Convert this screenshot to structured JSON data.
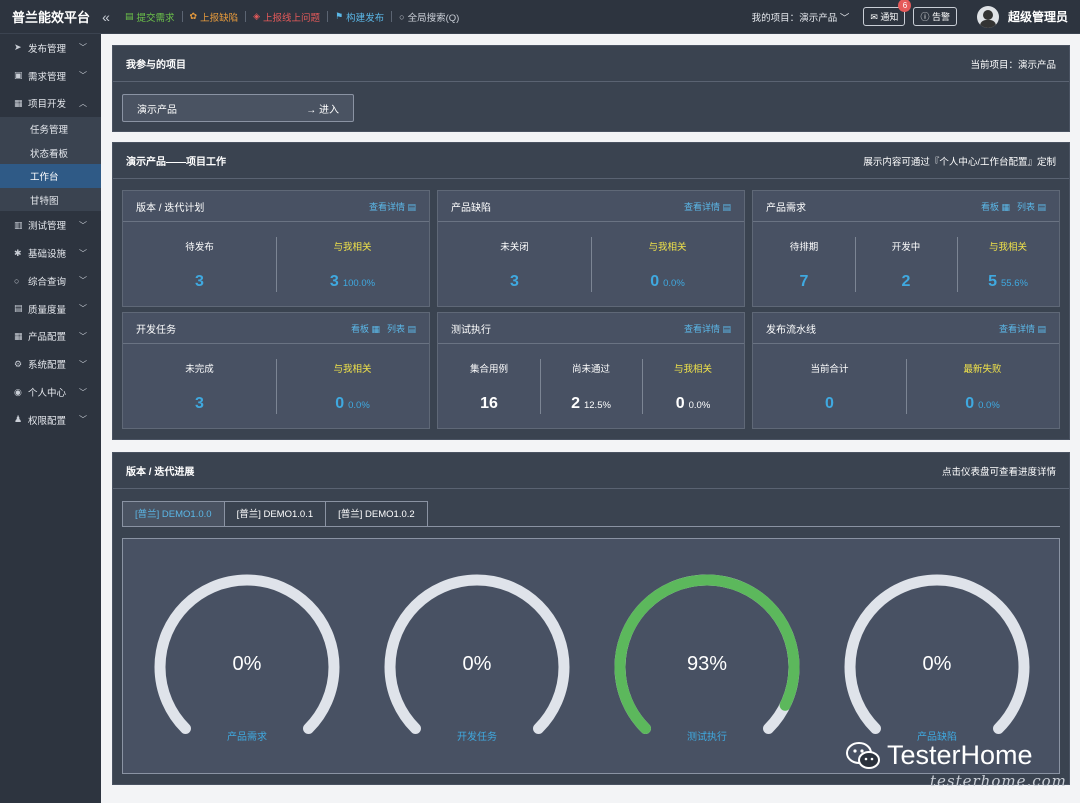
{
  "brand": "普兰能效平台",
  "collapse_icon": "«",
  "quick_links": [
    {
      "label": "提交需求",
      "color": "#6cc24a",
      "icon": "document-icon",
      "glyph": "▤"
    },
    {
      "label": "上报缺陷",
      "color": "#e89b3c",
      "icon": "bug-icon",
      "glyph": "✿"
    },
    {
      "label": "上报线上问题",
      "color": "#e55a5a",
      "icon": "warning-icon",
      "glyph": "◈"
    },
    {
      "label": "构建发布",
      "color": "#5bb8e8",
      "icon": "flag-icon",
      "glyph": "⚑"
    },
    {
      "label": "全局搜索(Q)",
      "color": "#c9ced6",
      "icon": "search-icon",
      "glyph": "○"
    }
  ],
  "header": {
    "my_project_label": "我的项目：",
    "my_project_value": "演示产品",
    "notify_label": "通知",
    "notify_badge": "6",
    "alarm_label": "告警",
    "user_name": "超级管理员"
  },
  "sidebar": {
    "items": [
      {
        "label": "发布管理",
        "icon": "send-icon",
        "glyph": "➤",
        "expanded": false
      },
      {
        "label": "需求管理",
        "icon": "requirement-icon",
        "glyph": "▣",
        "expanded": false
      },
      {
        "label": "项目开发",
        "icon": "project-icon",
        "glyph": "▦",
        "expanded": true
      },
      {
        "label": "测试管理",
        "icon": "test-icon",
        "glyph": "▥",
        "expanded": false
      },
      {
        "label": "基础设施",
        "icon": "infra-icon",
        "glyph": "✱",
        "expanded": false
      },
      {
        "label": "综合查询",
        "icon": "query-icon",
        "glyph": "○",
        "expanded": false
      },
      {
        "label": "质量度量",
        "icon": "quality-icon",
        "glyph": "▤",
        "expanded": false
      },
      {
        "label": "产品配置",
        "icon": "product-icon",
        "glyph": "▦",
        "expanded": false
      },
      {
        "label": "系统配置",
        "icon": "system-icon",
        "glyph": "⚙",
        "expanded": false
      },
      {
        "label": "个人中心",
        "icon": "user-icon",
        "glyph": "◉",
        "expanded": false
      },
      {
        "label": "权限配置",
        "icon": "permission-icon",
        "glyph": "♟",
        "expanded": false
      }
    ],
    "subitems": [
      {
        "label": "任务管理",
        "active": false
      },
      {
        "label": "状态看板",
        "active": false
      },
      {
        "label": "工作台",
        "active": true
      },
      {
        "label": "甘特图",
        "active": false
      }
    ]
  },
  "projects_panel": {
    "title": "我参与的项目",
    "current_label": "当前项目：演示产品",
    "project_name": "演示产品",
    "enter_label": "→ 进入"
  },
  "work_panel": {
    "title": "演示产品——项目工作",
    "hint": "展示内容可通过『个人中心/工作台配置』定制",
    "cards": [
      {
        "title": "版本 / 迭代计划",
        "links": [
          "查看详情 ▤"
        ],
        "stats": [
          {
            "label": "待发布",
            "value": "3",
            "pct": "",
            "hl": false
          },
          {
            "label": "与我相关",
            "value": "3",
            "pct": "100.0%",
            "hl": true
          }
        ]
      },
      {
        "title": "产品缺陷",
        "links": [
          "查看详情 ▤"
        ],
        "stats": [
          {
            "label": "未关闭",
            "value": "3",
            "pct": "",
            "hl": false
          },
          {
            "label": "与我相关",
            "value": "0",
            "pct": "0.0%",
            "hl": true
          }
        ]
      },
      {
        "title": "产品需求",
        "links": [
          "看板 ▦",
          "列表 ▤"
        ],
        "stats": [
          {
            "label": "待排期",
            "value": "7",
            "pct": "",
            "hl": false
          },
          {
            "label": "开发中",
            "value": "2",
            "pct": "",
            "hl": false
          },
          {
            "label": "与我相关",
            "value": "5",
            "pct": "55.6%",
            "hl": true
          }
        ]
      },
      {
        "title": "开发任务",
        "links": [
          "看板 ▦",
          "列表 ▤"
        ],
        "stats": [
          {
            "label": "未完成",
            "value": "3",
            "pct": "",
            "hl": false
          },
          {
            "label": "与我相关",
            "value": "0",
            "pct": "0.0%",
            "hl": true
          }
        ]
      },
      {
        "title": "测试执行",
        "links": [
          "查看详情 ▤"
        ],
        "white": true,
        "stats": [
          {
            "label": "集合用例",
            "value": "16",
            "pct": "",
            "hl": false
          },
          {
            "label": "尚未通过",
            "value": "2",
            "pct": "12.5%",
            "hl": false
          },
          {
            "label": "与我相关",
            "value": "0",
            "pct": "0.0%",
            "hl": true
          }
        ]
      },
      {
        "title": "发布流水线",
        "links": [
          "查看详情 ▤"
        ],
        "stats": [
          {
            "label": "当前合计",
            "value": "0",
            "pct": "",
            "hl": false
          },
          {
            "label": "最新失败",
            "value": "0",
            "pct": "0.0%",
            "hl": true
          }
        ]
      }
    ]
  },
  "progress_panel": {
    "title": "版本 / 迭代进展",
    "hint": "点击仪表盘可查看进度详情",
    "tabs": [
      {
        "label": "[普兰] DEMO1.0.0",
        "active": true
      },
      {
        "label": "[普兰] DEMO1.0.1",
        "active": false
      },
      {
        "label": "[普兰] DEMO1.0.2",
        "active": false
      }
    ],
    "gauges": [
      {
        "value": "0%",
        "fraction": 0.0,
        "label": "产品需求"
      },
      {
        "value": "0%",
        "fraction": 0.0,
        "label": "开发任务"
      },
      {
        "value": "93%",
        "fraction": 0.93,
        "label": "测试执行"
      },
      {
        "value": "0%",
        "fraction": 0.0,
        "label": "产品缺陷"
      }
    ],
    "colors": {
      "track": "#dfe3ea",
      "fill": "#5cb85c"
    }
  },
  "watermark": {
    "text": "TesterHome",
    "sub": "testerhome.com"
  }
}
